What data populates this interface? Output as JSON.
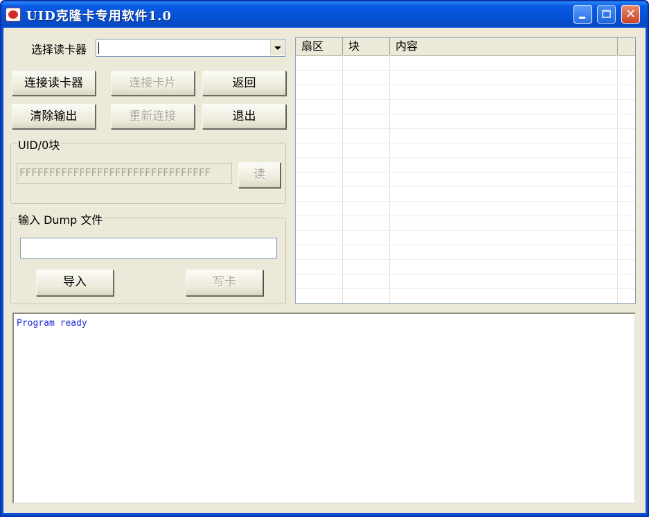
{
  "window": {
    "title": "UID克隆卡专用软件1.0",
    "controls": [
      "minimize-icon",
      "maximize-icon",
      "close-icon"
    ]
  },
  "reader": {
    "label": "选择读卡器",
    "selected": ""
  },
  "buttons": {
    "connect_reader": "连接读卡器",
    "connect_card": "连接卡片",
    "back": "返回",
    "clear_output": "清除输出",
    "reconnect": "重新连接",
    "exit": "退出",
    "read": "读",
    "import": "导入",
    "write_card": "写卡"
  },
  "uid_group": {
    "legend": "UID/0块",
    "value": "FFFFFFFFFFFFFFFFFFFFFFFFFFFFFFFF"
  },
  "dump_group": {
    "legend": "输入 Dump 文件",
    "value": ""
  },
  "table": {
    "columns": [
      "扇区",
      "块",
      "内容"
    ],
    "rows": []
  },
  "output": {
    "lines": [
      "Program ready"
    ]
  },
  "colors": {
    "titlebar": "#0652d6",
    "output_text": "#1a2bd6",
    "face": "#ece9d8"
  }
}
